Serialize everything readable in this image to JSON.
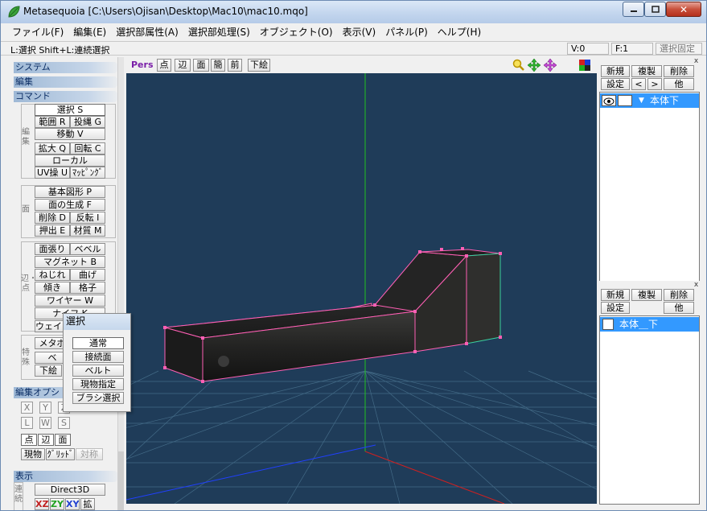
{
  "window": {
    "title": "Metasequoia [C:\\Users\\Ojisan\\Desktop\\Mac10\\mac10.mqo]",
    "min": "",
    "max": "",
    "close": "✕"
  },
  "menubar": [
    "ファイル(F)",
    "編集(E)",
    "選択部属性(A)",
    "選択部処理(S)",
    "オブジェクト(O)",
    "表示(V)",
    "パネル(P)",
    "ヘルプ(H)"
  ],
  "statusbar": {
    "hint": "L:選択  Shift+L:連続選択",
    "vertex": "V:0",
    "face": "F:1",
    "lock": "選択固定"
  },
  "left": {
    "system": "システム",
    "edit": "編集",
    "command": "コマンド",
    "group_edit": "編集",
    "select": "選択 S",
    "range": "範囲 R",
    "lasso": "投縄 G",
    "move": "移動 V",
    "scale": "拡大 Q",
    "rotate": "回転 C",
    "local": "ローカル",
    "uv": "UV操 U",
    "mapping": "ﾏｯﾋﾟﾝｸﾞ",
    "group_face": "面",
    "primitive": "基本図形 P",
    "face_create": "面の生成 F",
    "delete": "削除 D",
    "invert": "反転 I",
    "extrude": "押出 E",
    "material": "材質 M",
    "group_edge": "辺・点",
    "face_stretch": "面張り",
    "bevel": "ベベル",
    "magnet": "マグネット B",
    "twist": "ねじれ",
    "bend": "曲げ",
    "tilt": "傾き",
    "grid": "格子",
    "wire": "ワイヤー W",
    "knife": "ナイフ K",
    "weight": "ウェイト",
    "group_special": "特殊",
    "metaball": "メタボ",
    "belt_short": "ベ",
    "sketch": "下絵",
    "options": "編集オプシ",
    "ax_x": "X",
    "ax_y": "Y",
    "ax_z": "Z",
    "ax_l": "L",
    "ax_w": "W",
    "ax_s": "S",
    "pt": "点",
    "edge": "辺",
    "face": "面",
    "real": "現物",
    "gridbtn": "ｸﾞﾘｯﾄﾞ",
    "sym": "対称",
    "display": "表示",
    "direct3d": "Direct3D",
    "continue_label": "連続",
    "xz": "XZ",
    "zy": "ZY",
    "xy": "XY",
    "extra": "拡"
  },
  "popup": {
    "title": "選択",
    "items": [
      "通常",
      "接続面",
      "ベルト",
      "現物指定",
      "ブラシ選択"
    ]
  },
  "viewport": {
    "mode": "Pers",
    "buttons": [
      "点",
      "辺",
      "面",
      "簡",
      "前",
      "下絵"
    ]
  },
  "objects": {
    "new": "新規",
    "dup": "複製",
    "del": "削除",
    "settings": "設定",
    "prev": "<",
    "next": ">",
    "other": "他",
    "item": "本体下",
    "close": "x"
  },
  "materials": {
    "new": "新規",
    "dup": "複製",
    "del": "削除",
    "settings": "設定",
    "other": "他",
    "item": "本体＿下",
    "close": "x"
  },
  "colors": {
    "viewport_bg": "#1f3c59",
    "selection": "#3399ff",
    "wire": "#ff5fb4",
    "axis_green": "#20c020",
    "axis_red": "#d02020",
    "axis_blue": "#2040ff"
  },
  "icons": [
    "app-leaf-icon",
    "zoom-icon",
    "pan-icon",
    "rotate-icon",
    "palette-icon",
    "eye-icon",
    "lock-icon",
    "dropdown-arrow-icon"
  ]
}
